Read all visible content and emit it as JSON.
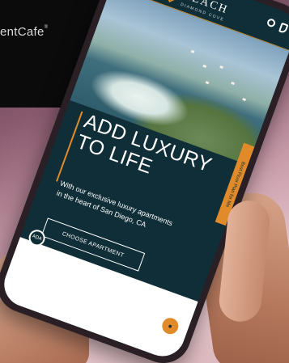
{
  "brand": {
    "text": "entCafe",
    "registered": "®"
  },
  "nav": {
    "logo_text": "REACH",
    "logo_sub": "DIAMOND COVE",
    "menu_icon": "hamburger-menu-icon",
    "user_icon": "user-icon",
    "phone_icon": "phone-icon"
  },
  "hero": {
    "headline": "ADD LUXURY TO LIFE",
    "subtext": "With our exclusive luxury apartments in the heart of San Diego, CA",
    "cta_label": "CHOOSE APARTMENT"
  },
  "side_tab": {
    "label": "Best Floor Plan for Me"
  },
  "badges": {
    "accessibility_badge": "ADA",
    "chat_icon": "chat-icon"
  },
  "colors": {
    "navy": "#0f2e37",
    "accent_orange": "#e08a2a"
  }
}
